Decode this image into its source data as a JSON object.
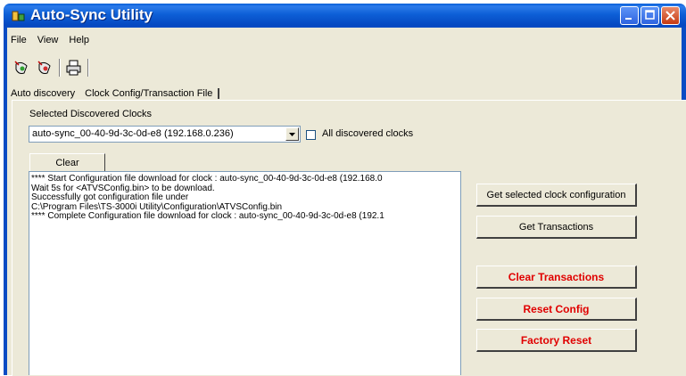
{
  "window": {
    "title": "Auto-Sync Utility"
  },
  "menu": [
    "File",
    "View",
    "Help"
  ],
  "toolbar": {
    "icons": [
      "discover-icon",
      "connect-icon",
      "print-icon"
    ]
  },
  "tabs": {
    "auto_discovery": "Auto discovery",
    "clock_config": "Clock Config/Transaction File"
  },
  "clocks": {
    "section_label": "Selected Discovered Clocks",
    "selected": "auto-sync_00-40-9d-3c-0d-e8 (192.168.0.236)",
    "all_label": "All discovered clocks",
    "all_checked": false
  },
  "log": {
    "clear_label": "Clear",
    "lines": [
      "**** Start Configuration file download for clock : auto-sync_00-40-9d-3c-0d-e8 (192.168.0",
      "Wait 5s for <ATVSConfig.bin> to be download.",
      "Successfully got configuration file under",
      "C:\\Program Files\\TS-3000i Utility\\Configuration\\ATVSConfig.bin",
      "**** Complete Configuration file download for clock : auto-sync_00-40-9d-3c-0d-e8 (192.1"
    ]
  },
  "actions": {
    "get_config": "Get selected clock configuration",
    "get_transactions": "Get Transactions",
    "clear_transactions": "Clear Transactions",
    "reset_config": "Reset Config",
    "factory_reset": "Factory Reset"
  },
  "colors": {
    "titlebar": "#0a4cc4",
    "danger": "#e00000",
    "face": "#ece9d8"
  }
}
